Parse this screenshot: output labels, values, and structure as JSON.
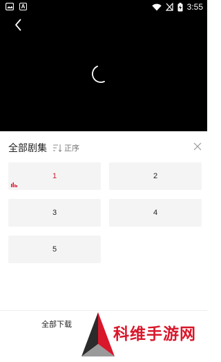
{
  "status_bar": {
    "notif_icon_a": "A",
    "time": "3:55",
    "battery_icon_label": "battery-charging"
  },
  "video": {
    "back_icon": "chevron-left-icon",
    "loading_icon": "spinner-icon"
  },
  "episodes_panel": {
    "title": "全部剧集",
    "sort_label": "正序",
    "close_icon": "close-icon",
    "episodes": [
      "1",
      "2",
      "3",
      "4",
      "5"
    ],
    "active_color": "#d8172b"
  },
  "bottom_bar": {
    "download_all_label": "全部下载"
  },
  "watermark": {
    "text": "科维手游网"
  }
}
